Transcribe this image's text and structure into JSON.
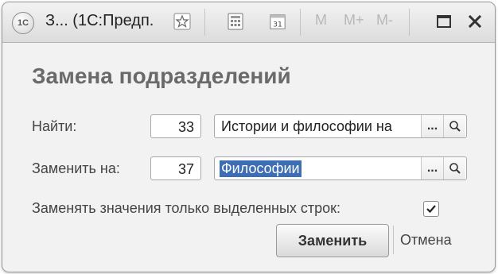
{
  "window": {
    "title": "З... (1С:Предп.",
    "logo_text": "1С",
    "toolbar": {
      "favorite_icon": "star-icon",
      "calculator_icon": "calculator-icon",
      "calendar_icon": "calendar-icon",
      "calendar_day": "31",
      "m_label": "M",
      "mplus_label": "M+",
      "mminus_label": "M-"
    }
  },
  "form": {
    "heading": "Замена подразделений",
    "find": {
      "label": "Найти:",
      "code": "33",
      "value": "Истории и философии на"
    },
    "replace": {
      "label": "Заменить на:",
      "code": "37",
      "value": "Философии"
    },
    "only_selected": {
      "label": "Заменять значения только выделенных строк:",
      "checked": true
    },
    "buttons": {
      "replace": "Заменить",
      "cancel": "Отмена"
    },
    "field_buttons": {
      "choose": "...",
      "search_icon": "search-icon"
    }
  },
  "colors": {
    "selection": "#3d6db5",
    "heading": "#6a6a6a"
  }
}
